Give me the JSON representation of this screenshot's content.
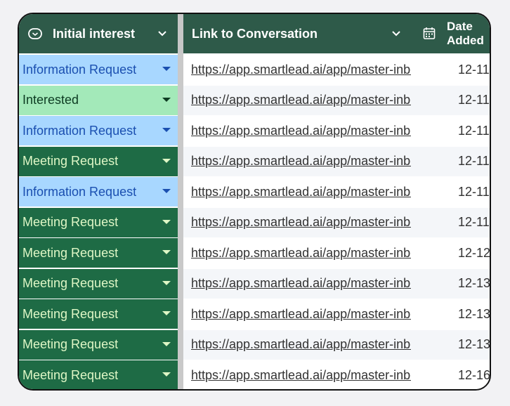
{
  "header": {
    "col1_label": "Initial interest",
    "col2_label": "Link to Conversation",
    "col3_label_line1": "Date",
    "col3_label_line2": "Added"
  },
  "colors": {
    "header_bg": "#2e5a49",
    "information_request_bg": "#a8d7ff",
    "information_request_text": "#1a4fb0",
    "interested_bg": "#a3e9b9",
    "interested_text": "#0d3b22",
    "meeting_request_bg": "#1e6b45",
    "meeting_request_text": "#dff7c6"
  },
  "rows": [
    {
      "interest": "Information Request",
      "interest_type": "info",
      "link": "https://app.smartlead.ai/app/master-inbox",
      "date": "12-11"
    },
    {
      "interest": "Interested",
      "interest_type": "interested",
      "link": "https://app.smartlead.ai/app/master-inbox",
      "date": "12-11"
    },
    {
      "interest": "Information Request",
      "interest_type": "info",
      "link": "https://app.smartlead.ai/app/master-inbox",
      "date": "12-11"
    },
    {
      "interest": "Meeting Request",
      "interest_type": "meeting",
      "link": "https://app.smartlead.ai/app/master-inbox",
      "date": "12-11"
    },
    {
      "interest": "Information Request",
      "interest_type": "info",
      "link": "https://app.smartlead.ai/app/master-inbox",
      "date": "12-11"
    },
    {
      "interest": "Meeting Request",
      "interest_type": "meeting",
      "link": "https://app.smartlead.ai/app/master-inbox",
      "date": "12-11"
    },
    {
      "interest": "Meeting Request",
      "interest_type": "meeting",
      "link": "https://app.smartlead.ai/app/master-inbox",
      "date": "12-12"
    },
    {
      "interest": "Meeting Request",
      "interest_type": "meeting",
      "link": "https://app.smartlead.ai/app/master-inbox",
      "date": "12-13"
    },
    {
      "interest": "Meeting Request",
      "interest_type": "meeting",
      "link": "https://app.smartlead.ai/app/master-inbox",
      "date": "12-13"
    },
    {
      "interest": "Meeting Request",
      "interest_type": "meeting",
      "link": "https://app.smartlead.ai/app/master-inbox",
      "date": "12-13"
    },
    {
      "interest": "Meeting Request",
      "interest_type": "meeting",
      "link": "https://app.smartlead.ai/app/master-inbox",
      "date": "12-16"
    }
  ],
  "icons": {
    "col1_icon": "dropdown-chip-icon",
    "col1_menu": "chevron-down-icon",
    "col2_menu": "chevron-down-icon",
    "col3_icon": "calendar-icon"
  }
}
